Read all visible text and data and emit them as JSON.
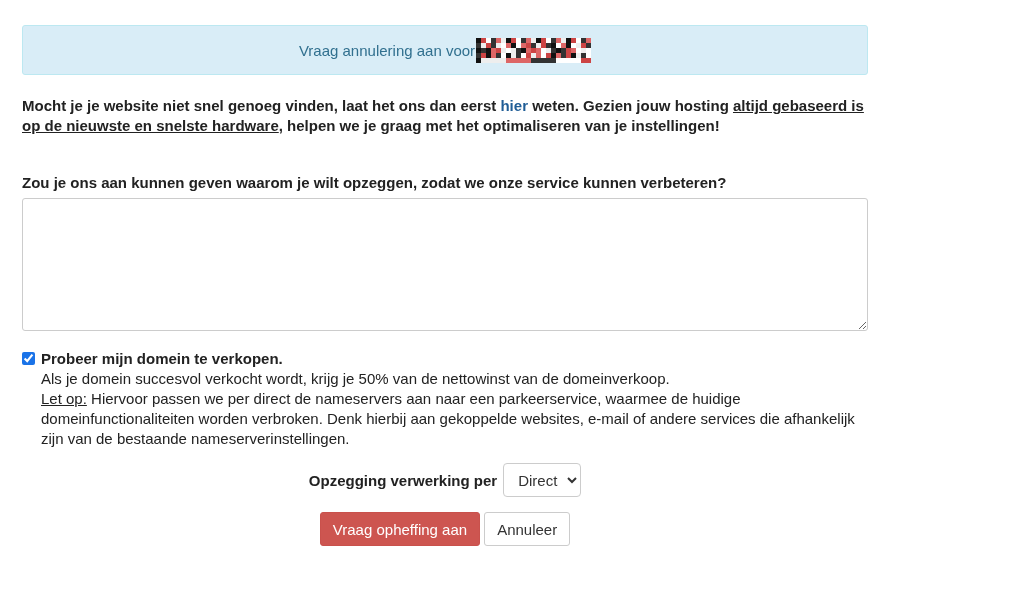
{
  "alert": {
    "text": "Vraag annulering aan voor"
  },
  "intro": [
    {
      "kind": "plain",
      "text": "Mocht je je website niet snel genoeg vinden, laat het ons dan eerst "
    },
    {
      "kind": "link",
      "text": "hier"
    },
    {
      "kind": "plain",
      "text": " weten. Gezien jouw hosting "
    },
    {
      "kind": "underlined",
      "text": "altijd gebaseerd is op de nieuwste en snelste hardware"
    },
    {
      "kind": "plain",
      "text": ", helpen we je graag met het optimaliseren van je instellingen!"
    }
  ],
  "reason": {
    "label": "Zou je ons aan kunnen geven waarom je wilt opzeggen, zodat we onze service kunnen verbeteren?"
  },
  "sell_domain": {
    "checked": true,
    "label": "Probeer mijn domein te verkopen.",
    "notes": [
      [
        {
          "kind": "plain",
          "text": "Als je domein succesvol verkocht wordt, krijg je 50% van de nettowinst van de domeinverkoop."
        }
      ],
      [
        {
          "kind": "underlined",
          "text": "Let op:"
        },
        {
          "kind": "plain",
          "text": " Hiervoor passen we per direct de nameservers aan naar een parkeerservice, waarmee de huidige domeinfunctionaliteiten worden verbroken. Denk hierbij aan gekoppelde websites, e-mail of andere services die afhankelijk zijn van de bestaande nameserverinstellingen."
        }
      ]
    ]
  },
  "processing": {
    "label": "Opzegging verwerking per",
    "value": "Direct"
  },
  "buttons": [
    {
      "kind": "primary",
      "label": "Vraag opheffing aan"
    },
    {
      "kind": "default",
      "label": "Annuleer"
    }
  ]
}
